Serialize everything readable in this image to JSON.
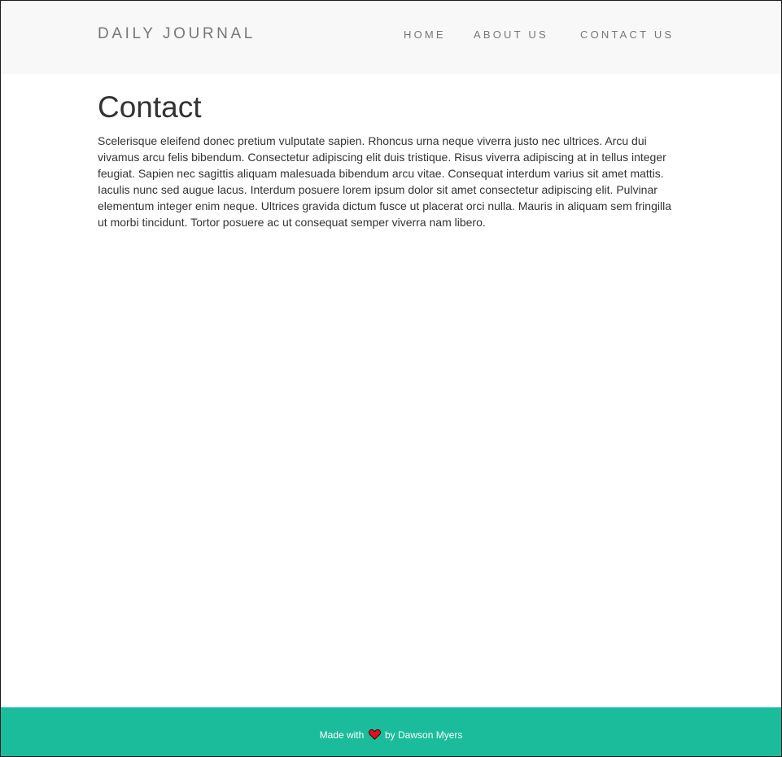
{
  "header": {
    "brand": "DAILY JOURNAL",
    "nav": {
      "home": "HOME",
      "about": "ABOUT US",
      "contact": "CONTACT US"
    },
    "background_color": "#f8f8f8",
    "text_color": "#777777"
  },
  "main": {
    "title": "Contact",
    "body": "Scelerisque eleifend donec pretium vulputate sapien. Rhoncus urna neque viverra justo nec ultrices. Arcu dui vivamus arcu felis bibendum. Consectetur adipiscing elit duis tristique. Risus viverra adipiscing at in tellus integer feugiat. Sapien nec sagittis aliquam malesuada bibendum arcu vitae. Consequat interdum varius sit amet mattis. Iaculis nunc sed augue lacus. Interdum posuere lorem ipsum dolor sit amet consectetur adipiscing elit. Pulvinar elementum integer enim neque. Ultrices gravida dictum fusce ut placerat orci nulla. Mauris in aliquam sem fringilla ut morbi tincidunt. Tortor posuere ac ut consequat semper viverra nam libero."
  },
  "footer": {
    "prefix": "Made with",
    "icon": "heart-icon",
    "suffix": "by Dawson Myers",
    "background_color": "#1abc9c",
    "heart_color": "#e0101e"
  }
}
